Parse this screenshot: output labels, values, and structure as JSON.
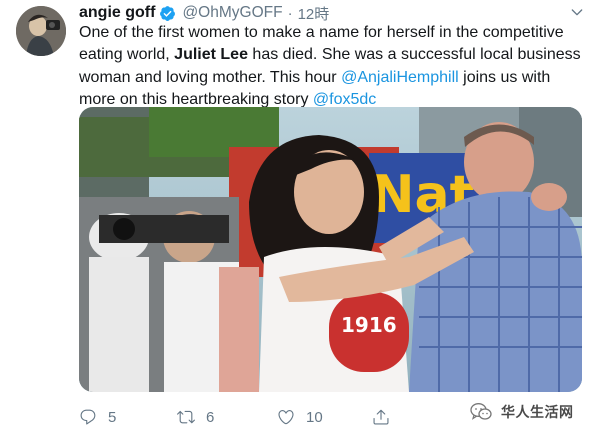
{
  "tweet": {
    "author_name": "angie goff",
    "handle": "@OhMyGOFF",
    "separator": "·",
    "time": "12時",
    "text_lines": [
      [
        "One of the first women to make a name for herself in the competitive"
      ],
      [
        "eating world, ",
        "Juliet Lee",
        " has died.  She was a successful local business"
      ],
      [
        "woman and loving mother. This hour ",
        "@AnjaliHemphill",
        " joins us with"
      ],
      [
        "more on this heartbreaking story ",
        "@fox5dc"
      ]
    ],
    "line1": "One of the first women to make a name for herself in the competitive",
    "line2_pre": "eating world, ",
    "line2_bold": "Juliet Lee",
    "line2_post": " has died.  She was a successful local business",
    "line3_pre": "woman and loving mother. This hour ",
    "line3_link": "@AnjaliHemphill",
    "line3_post": " joins us with",
    "line4_pre": "more on this heartbreaking story ",
    "line4_link": "@fox5dc",
    "photo_sign_text": "Nat",
    "photo_shirt_text": "1916",
    "reply_count": "5",
    "retweet_count": "6",
    "like_count": "10"
  },
  "watermark": {
    "text": "华人生活网"
  },
  "icons": {
    "verified": "verified-badge-icon",
    "caret": "chevron-down-icon",
    "reply": "reply-icon",
    "retweet": "retweet-icon",
    "like": "heart-icon",
    "share": "share-icon",
    "watermark": "wechat-icon"
  },
  "colors": {
    "link": "#1b95e0",
    "muted": "#657786",
    "text": "#14171a",
    "verified": "#1da1f2"
  }
}
